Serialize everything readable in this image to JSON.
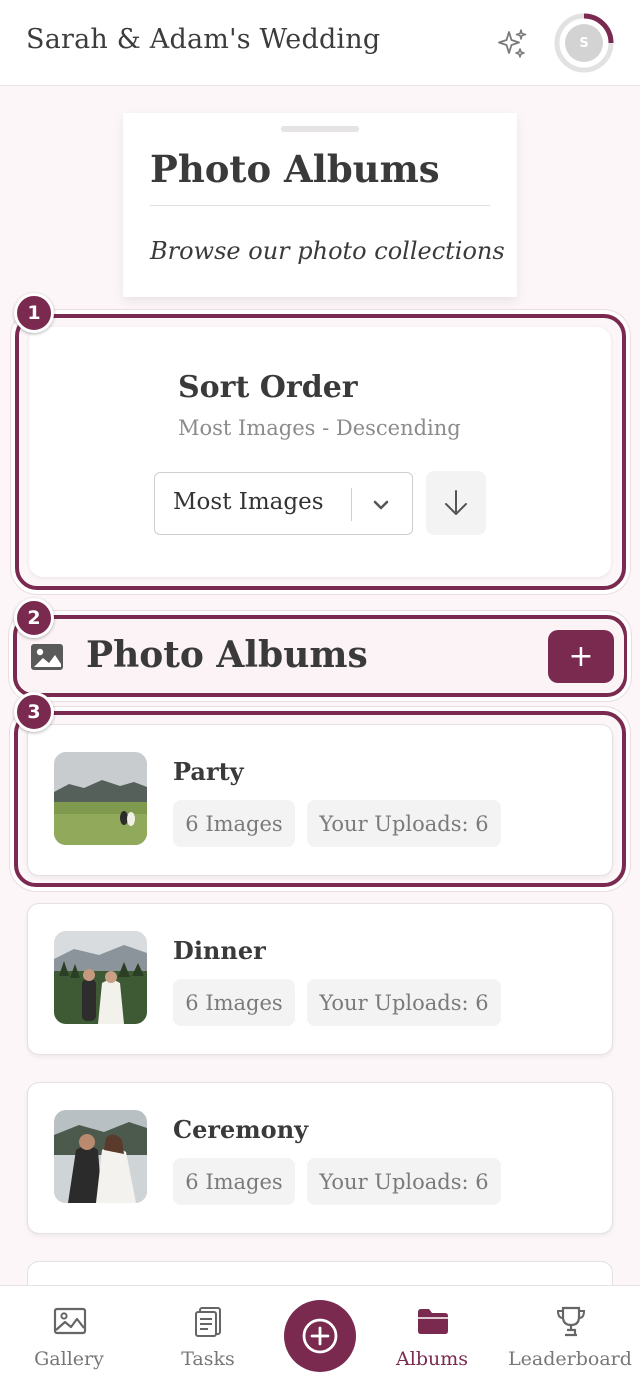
{
  "header": {
    "title": "Sarah & Adam's Wedding",
    "avatar_initial": "S"
  },
  "page": {
    "title": "Photo Albums",
    "subtitle": "Browse our photo collections"
  },
  "sort": {
    "title": "Sort Order",
    "subtitle": "Most Images - Descending",
    "selected": "Most Images"
  },
  "section": {
    "title": "Photo Albums",
    "add_label": "+"
  },
  "highlights": [
    "1",
    "2",
    "3"
  ],
  "albums": [
    {
      "name": "Party",
      "count": "6 Images",
      "uploads": "Your Uploads: 6"
    },
    {
      "name": "Dinner",
      "count": "6 Images",
      "uploads": "Your Uploads: 6"
    },
    {
      "name": "Ceremony",
      "count": "6 Images",
      "uploads": "Your Uploads: 6"
    }
  ],
  "nav": {
    "items": [
      {
        "label": "Gallery",
        "icon": "image-icon"
      },
      {
        "label": "Tasks",
        "icon": "clipboard-icon"
      },
      {
        "label": "Albums",
        "icon": "folder-icon"
      },
      {
        "label": "Leaderboard",
        "icon": "trophy-icon"
      }
    ],
    "active": "Albums"
  },
  "colors": {
    "accent": "#7a2a4f",
    "background": "#fcf6f8"
  }
}
